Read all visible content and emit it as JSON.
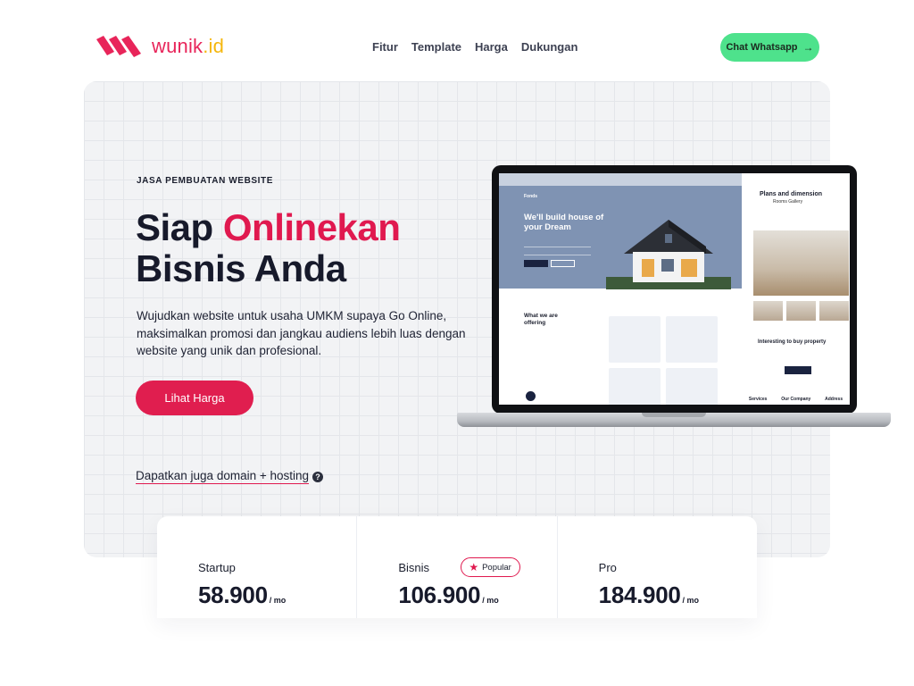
{
  "header": {
    "brand_name": "wunik",
    "brand_tld": ".id",
    "nav": [
      "Fitur",
      "Template",
      "Harga",
      "Dukungan"
    ],
    "cta_label": "Chat Whatsapp",
    "cta_icon": "arrow-right-icon"
  },
  "hero": {
    "kicker": "JASA PEMBUATAN WEBSITE",
    "headline_part1": "Siap ",
    "headline_accent": "Onlinekan",
    "headline_line2": "Bisnis Anda",
    "description": "Wujudkan website untuk usaha UMKM supaya Go Online, maksimalkan promosi dan jangkau audiens lebih luas dengan website yang unik dan profesional.",
    "button_label": "Lihat Harga",
    "domain_link": "Dapatkan juga domain + hosting",
    "help_icon": "question-icon"
  },
  "mock_site": {
    "logo": "Fonds",
    "headline": "We'll build house of your Dream",
    "offer_title": "What we are offering",
    "plans_title": "Plans and dimension",
    "plans_sub": "Rooms Gallery",
    "interest_title": "Interesting to buy property",
    "footer": [
      "Services",
      "Our Company",
      "Address"
    ]
  },
  "pricing": {
    "plans": [
      {
        "name": "Startup",
        "price": "58.900",
        "per": "/ mo"
      },
      {
        "name": "Bisnis",
        "price": "106.900",
        "per": "/ mo",
        "badge": "Popular"
      },
      {
        "name": "Pro",
        "price": "184.900",
        "per": "/ mo"
      }
    ]
  },
  "colors": {
    "accent": "#e0194f",
    "brand_yellow": "#f5b70d",
    "whatsapp_green": "#4ee28c",
    "dark": "#171a2b"
  }
}
